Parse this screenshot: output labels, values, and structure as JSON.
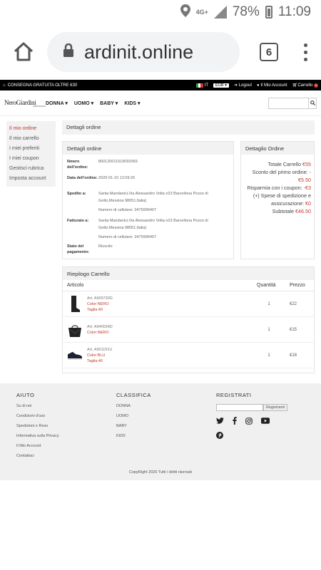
{
  "status": {
    "network": "4G+",
    "battery": "78%",
    "time": "11:09"
  },
  "browser": {
    "url": "ardinit.online",
    "tab_count": "6"
  },
  "topbar": {
    "promo": "CONSEGNA GRATUITA OLTRE €30",
    "lang": "IT",
    "currency": "EUR",
    "logout": "Logout",
    "account": "Il Mio Account",
    "cart": "Carrello",
    "cart_count": "0"
  },
  "nav": {
    "logo": "NeroGiardini",
    "logo_sub": "MADE IN ITALY",
    "items": [
      "DONNA",
      "UOMO",
      "BABY",
      "KIDS"
    ]
  },
  "sidebar": {
    "items": [
      "Il mio ordine",
      "Il mio carrello",
      "I miei preferiti",
      "I miei coupon",
      "Gestisci rubrica",
      "Imposta account"
    ]
  },
  "page_title": "Dettagli ordine",
  "order_details": {
    "title": "Dettagli ordine",
    "number_label": "Nmero dell'ordine:",
    "number": "800120011519092069",
    "date_label": "Data dell'ordine:",
    "date": "2020-01-15 12:09:20",
    "shipped_label": "Spedito a:",
    "shipped_address": "Santa Mandanici,Via Alessandro Volta n23 Barcellona Pozzo di Gotto,Messina 98051,Italia)",
    "shipped_phone": "Numero di cellulare: 3475996407",
    "billed_label": "Fatturato a:",
    "billed_address": "Santa Mandanici,Via Alessandro Volta n23 Barcellona Pozzo di Gotto,Messina 98051,Italia)",
    "billed_phone": "Numero di cellulare: 3475996407",
    "payment_label": "Stato del pagamento:",
    "payment": "Riuscito"
  },
  "order_summary": {
    "title": "Dettaglio Ordine",
    "total_label": "Totale Carrello",
    "total": "€55",
    "discount_label": "Sconto del primo ordine:",
    "discount": "-€5.50",
    "coupon_label": "Risparmia con i coupon:",
    "coupon": "-€3",
    "shipping_label": "(+) Spese di spedizione e assicurazione:",
    "shipping": "€0",
    "subtotal_label": "Subtotale",
    "subtotal": "€46.50"
  },
  "cart": {
    "title": "Riepilogo Carrello",
    "headers": {
      "article": "Articolo",
      "qty": "Quantità",
      "price": "Prezzo"
    },
    "rows": [
      {
        "art": "Art. A909730D",
        "color": "Color:NERO",
        "size": "Taglia:40",
        "qty": "1",
        "price": "€22"
      },
      {
        "art": "Art. A940034D",
        "color": "Color:NERO",
        "size": "",
        "qty": "1",
        "price": "€15"
      },
      {
        "art": "Art. A901191U",
        "color": "Color:BLU",
        "size": "Taglia:40",
        "qty": "1",
        "price": "€18"
      }
    ]
  },
  "footer": {
    "aiuto_title": "AIUTO",
    "aiuto_links": [
      "Su di noi",
      "Condizioni d'uso",
      "Spedizioni e Reso",
      "Informativa sulla Privacy",
      "Il Mio Account",
      "Contattaci"
    ],
    "classifica_title": "CLASSIFICA",
    "classifica_links": [
      "DONNA",
      "UOMO",
      "BABY",
      "KIDS"
    ],
    "registrati_title": "REGISTRATI",
    "register_button": "Registrami",
    "copyright": "CopyRight 2020 Tutti i diritti riservati"
  }
}
